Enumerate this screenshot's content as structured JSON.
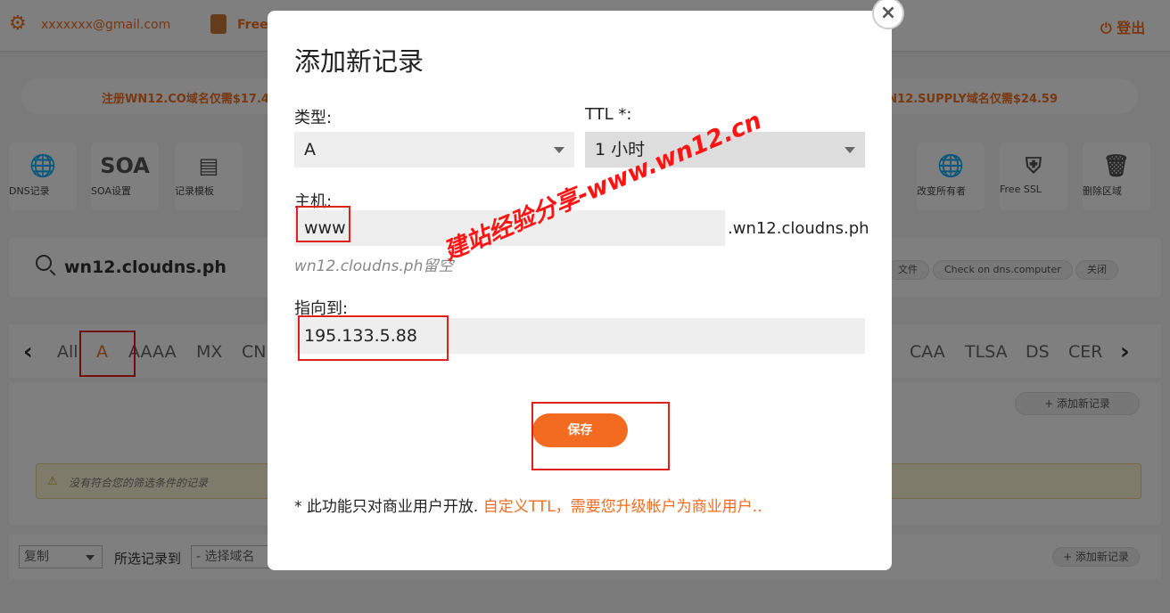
{
  "background": {
    "account_email": "xxxxxxx@gmail.com",
    "plan": "Free",
    "logout": "登出",
    "promo_left": "注册WN12.CO域名仅需$17.4",
    "promo_right": "N12.SUPPLY域名仅需$24.59",
    "tools": [
      {
        "label": "DNS记录",
        "icon": "globe-icon"
      },
      {
        "label": "SOA设置",
        "icon": "soa-icon"
      },
      {
        "label": "记录模板",
        "icon": "template-icon"
      },
      {
        "label": "改变所有者",
        "icon": "transfer-owner-icon"
      },
      {
        "label": "Free SSL",
        "icon": "ssl-shield-icon"
      },
      {
        "label": "删除区域",
        "icon": "trash-icon"
      }
    ],
    "soa_glyph": "SOA",
    "domain": "wn12.cloudns.ph",
    "pills": [
      "文件",
      "Check on dns.computer",
      "关闭"
    ],
    "record_tabs_left": [
      "All",
      "A",
      "AAAA",
      "MX",
      "CN"
    ],
    "record_tabs_right": [
      "CAA",
      "TLSA",
      "DS",
      "CER"
    ],
    "add_record_top": "+ 添加新记录",
    "empty_message": "没有符合您的筛选条件的记录",
    "copy_select": "复制",
    "move_label": "所选记录到",
    "domain_select_placeholder": "- 选择域名",
    "add_record_bottom": "+ 添加新记录"
  },
  "modal": {
    "title": "添加新记录",
    "close": "×",
    "type_label": "类型:",
    "type_value": "A",
    "ttl_label": "TTL *:",
    "ttl_value": "1 小时",
    "host_label": "主机:",
    "host_value": "www",
    "host_suffix": ".wn12.cloudns.ph",
    "host_hint": "wn12.cloudns.ph留空",
    "points_to_label": "指向到:",
    "points_to_value": "195.133.5.88",
    "save_label": "保存",
    "note_prefix": "* 此功能只对商业用户开放.",
    "note_link": "自定义TTL，需要您升级帐户为商业用户.."
  },
  "watermark": "建站经验分享-www.wn12.cn",
  "colors": {
    "accent": "#f36a21",
    "highlight_box": "#e0201c",
    "watermark": "#ff1414"
  }
}
